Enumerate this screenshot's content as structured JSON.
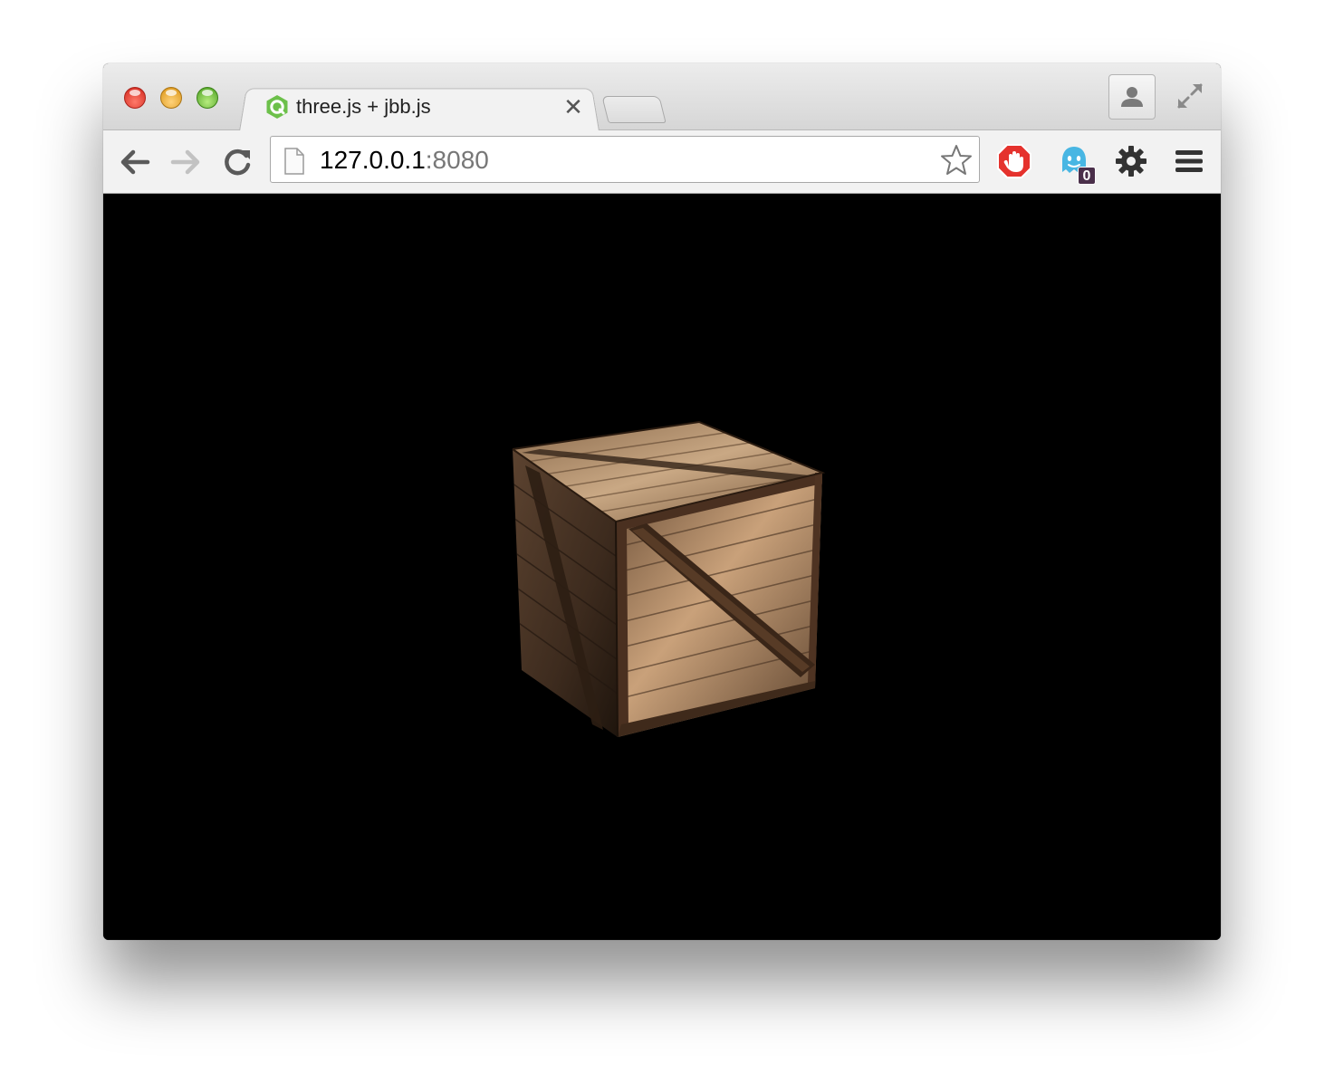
{
  "window": {
    "traffic_lights": [
      "close",
      "minimize",
      "zoom"
    ]
  },
  "tab": {
    "title": "three.js + jbb.js",
    "favicon": "green-hexagon-q-icon",
    "close_glyph": "✕"
  },
  "toolbar": {
    "back_icon": "back-arrow-icon",
    "forward_icon": "forward-arrow-icon",
    "reload_icon": "reload-icon",
    "url_host": "127.0.0.1",
    "url_port": ":8080",
    "star_icon": "bookmark-star-icon",
    "extensions": [
      {
        "name": "adblock-icon",
        "color": "#e5322d"
      },
      {
        "name": "ghostery-icon",
        "color": "#48b6e3",
        "badge": "0"
      },
      {
        "name": "gear-icon",
        "color": "#333333"
      }
    ],
    "menu_icon": "hamburger-menu-icon"
  },
  "viewport": {
    "background": "#000000",
    "content": "wooden-crate"
  },
  "colors": {
    "tab_bg": "#f2f2f2",
    "toolbar_bg": "#f2f2f2",
    "accent_green": "#6cc04a"
  }
}
